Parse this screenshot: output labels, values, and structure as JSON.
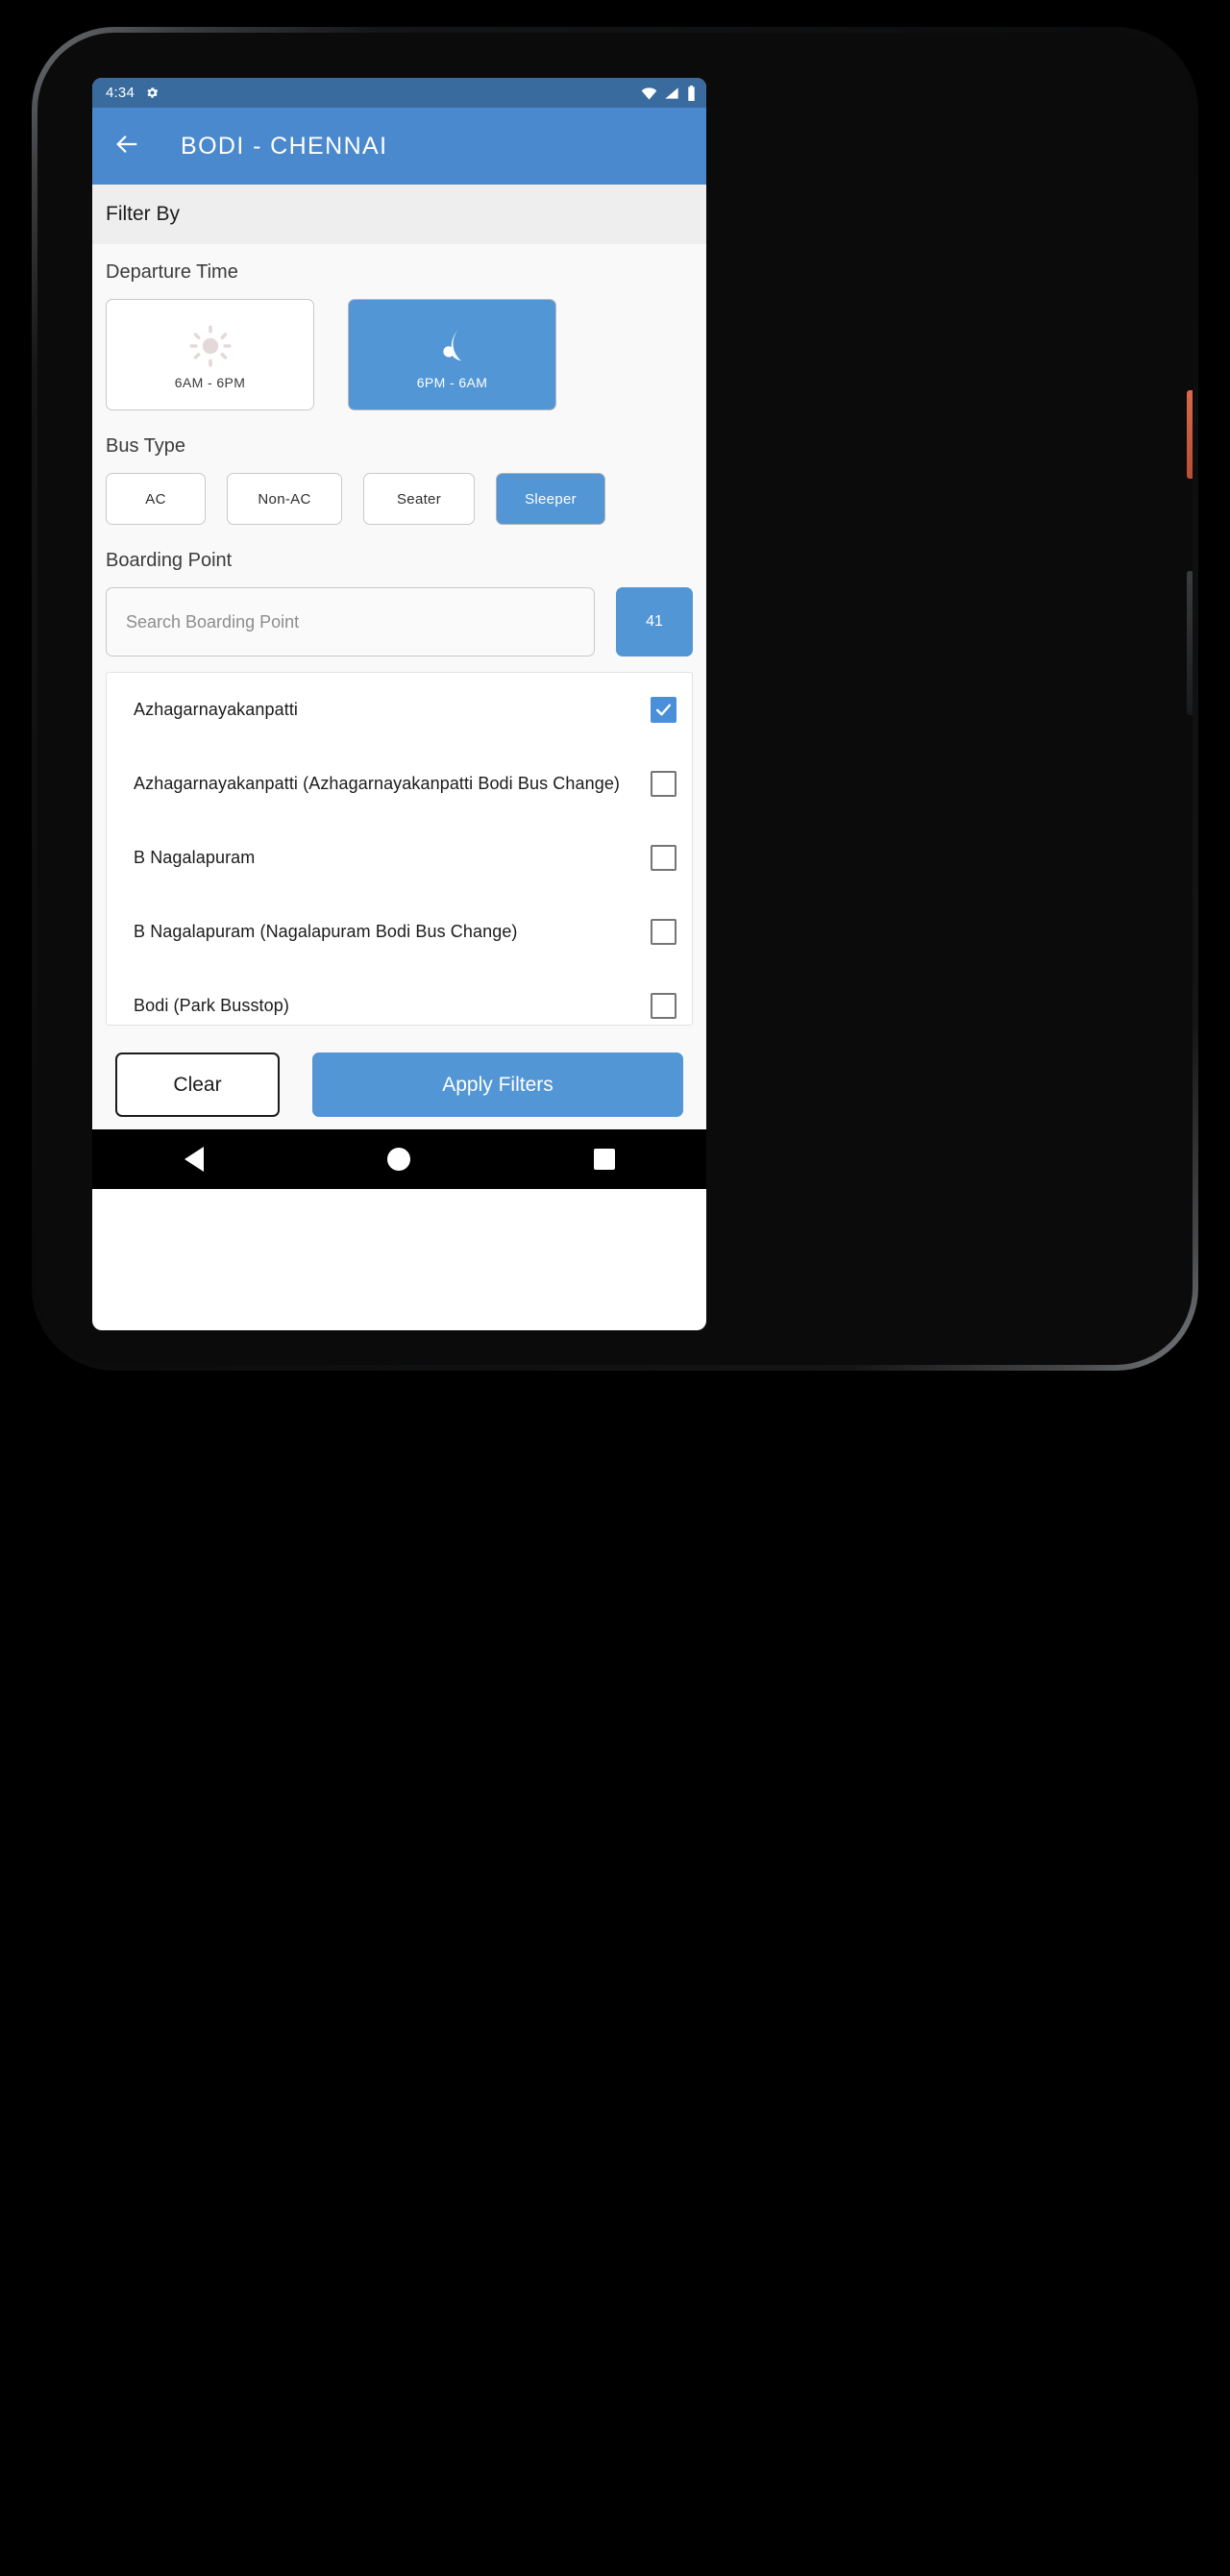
{
  "status_bar": {
    "time": "4:34",
    "icons": [
      "gear-icon",
      "wifi-icon",
      "cell-signal-icon",
      "battery-icon"
    ]
  },
  "app_bar": {
    "back_icon": "arrow-left-icon",
    "title": "BODI - CHENNAI"
  },
  "filter_header": {
    "title": "Filter By"
  },
  "departure_time": {
    "section_title": "Departure Time",
    "options": [
      {
        "label": "6AM - 6PM",
        "icon": "sun-icon",
        "selected": false
      },
      {
        "label": "6PM - 6AM",
        "icon": "moon-icon",
        "selected": true
      }
    ]
  },
  "bus_type": {
    "section_title": "Bus Type",
    "options": [
      {
        "label": "AC",
        "selected": false
      },
      {
        "label": "Non-AC",
        "selected": false
      },
      {
        "label": "Seater",
        "selected": false
      },
      {
        "label": "Sleeper",
        "selected": true
      }
    ]
  },
  "boarding_point": {
    "section_title": "Boarding Point",
    "search_value": "",
    "search_placeholder": "Search Boarding Point",
    "count_badge": "41",
    "items": [
      {
        "label": "Azhagarnayakanpatti",
        "checked": true
      },
      {
        "label": "Azhagarnayakanpatti (Azhagarnayakanpatti Bodi Bus Change)",
        "checked": false
      },
      {
        "label": "B Nagalapuram",
        "checked": false
      },
      {
        "label": "B Nagalapuram (Nagalapuram Bodi Bus Change)",
        "checked": false
      },
      {
        "label": "Bodi (Park Busstop)",
        "checked": false
      }
    ]
  },
  "bottom_actions": {
    "clear_label": "Clear",
    "apply_label": "Apply Filters"
  },
  "nav_bar": {
    "back": "nav-back-icon",
    "home": "nav-home-icon",
    "recents": "nav-recents-icon"
  },
  "colors": {
    "status_bar": "#3a6b9e",
    "app_bar": "#4a89cd",
    "accent": "#5296d5",
    "checkbox_checked": "#4a90d9",
    "sun_icon": "#e5d8d8",
    "page_bg": "#f9f9f9",
    "filter_header_bg": "#eeeeee"
  }
}
